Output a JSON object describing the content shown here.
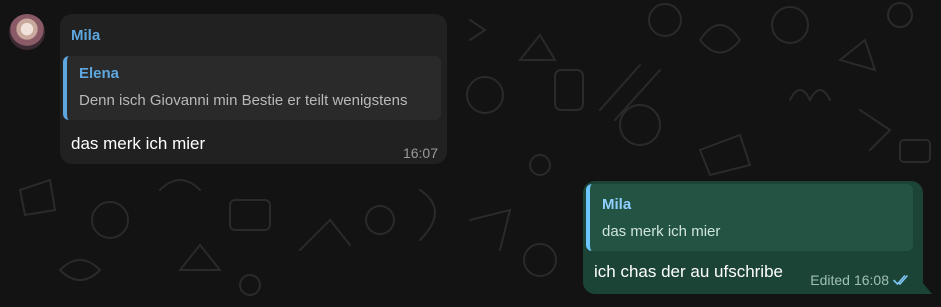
{
  "incoming": {
    "sender": "Mila",
    "reply": {
      "name": "Elena",
      "text": "Denn isch Giovanni min Bestie er teilt wenigstens"
    },
    "text": "das merk ich mier",
    "time": "16:07"
  },
  "outgoing": {
    "reply": {
      "name": "Mila",
      "text": "das merk ich mier"
    },
    "text": "ich chas der au ufschribe",
    "edited": "Edited",
    "time": "16:08"
  },
  "icons": {
    "read_status": "double-check-icon",
    "avatar": "avatar"
  },
  "colors": {
    "background": "#131313",
    "incoming_bubble": "#212121",
    "outgoing_bubble": "#1b4436",
    "accent": "#5ea7de"
  }
}
